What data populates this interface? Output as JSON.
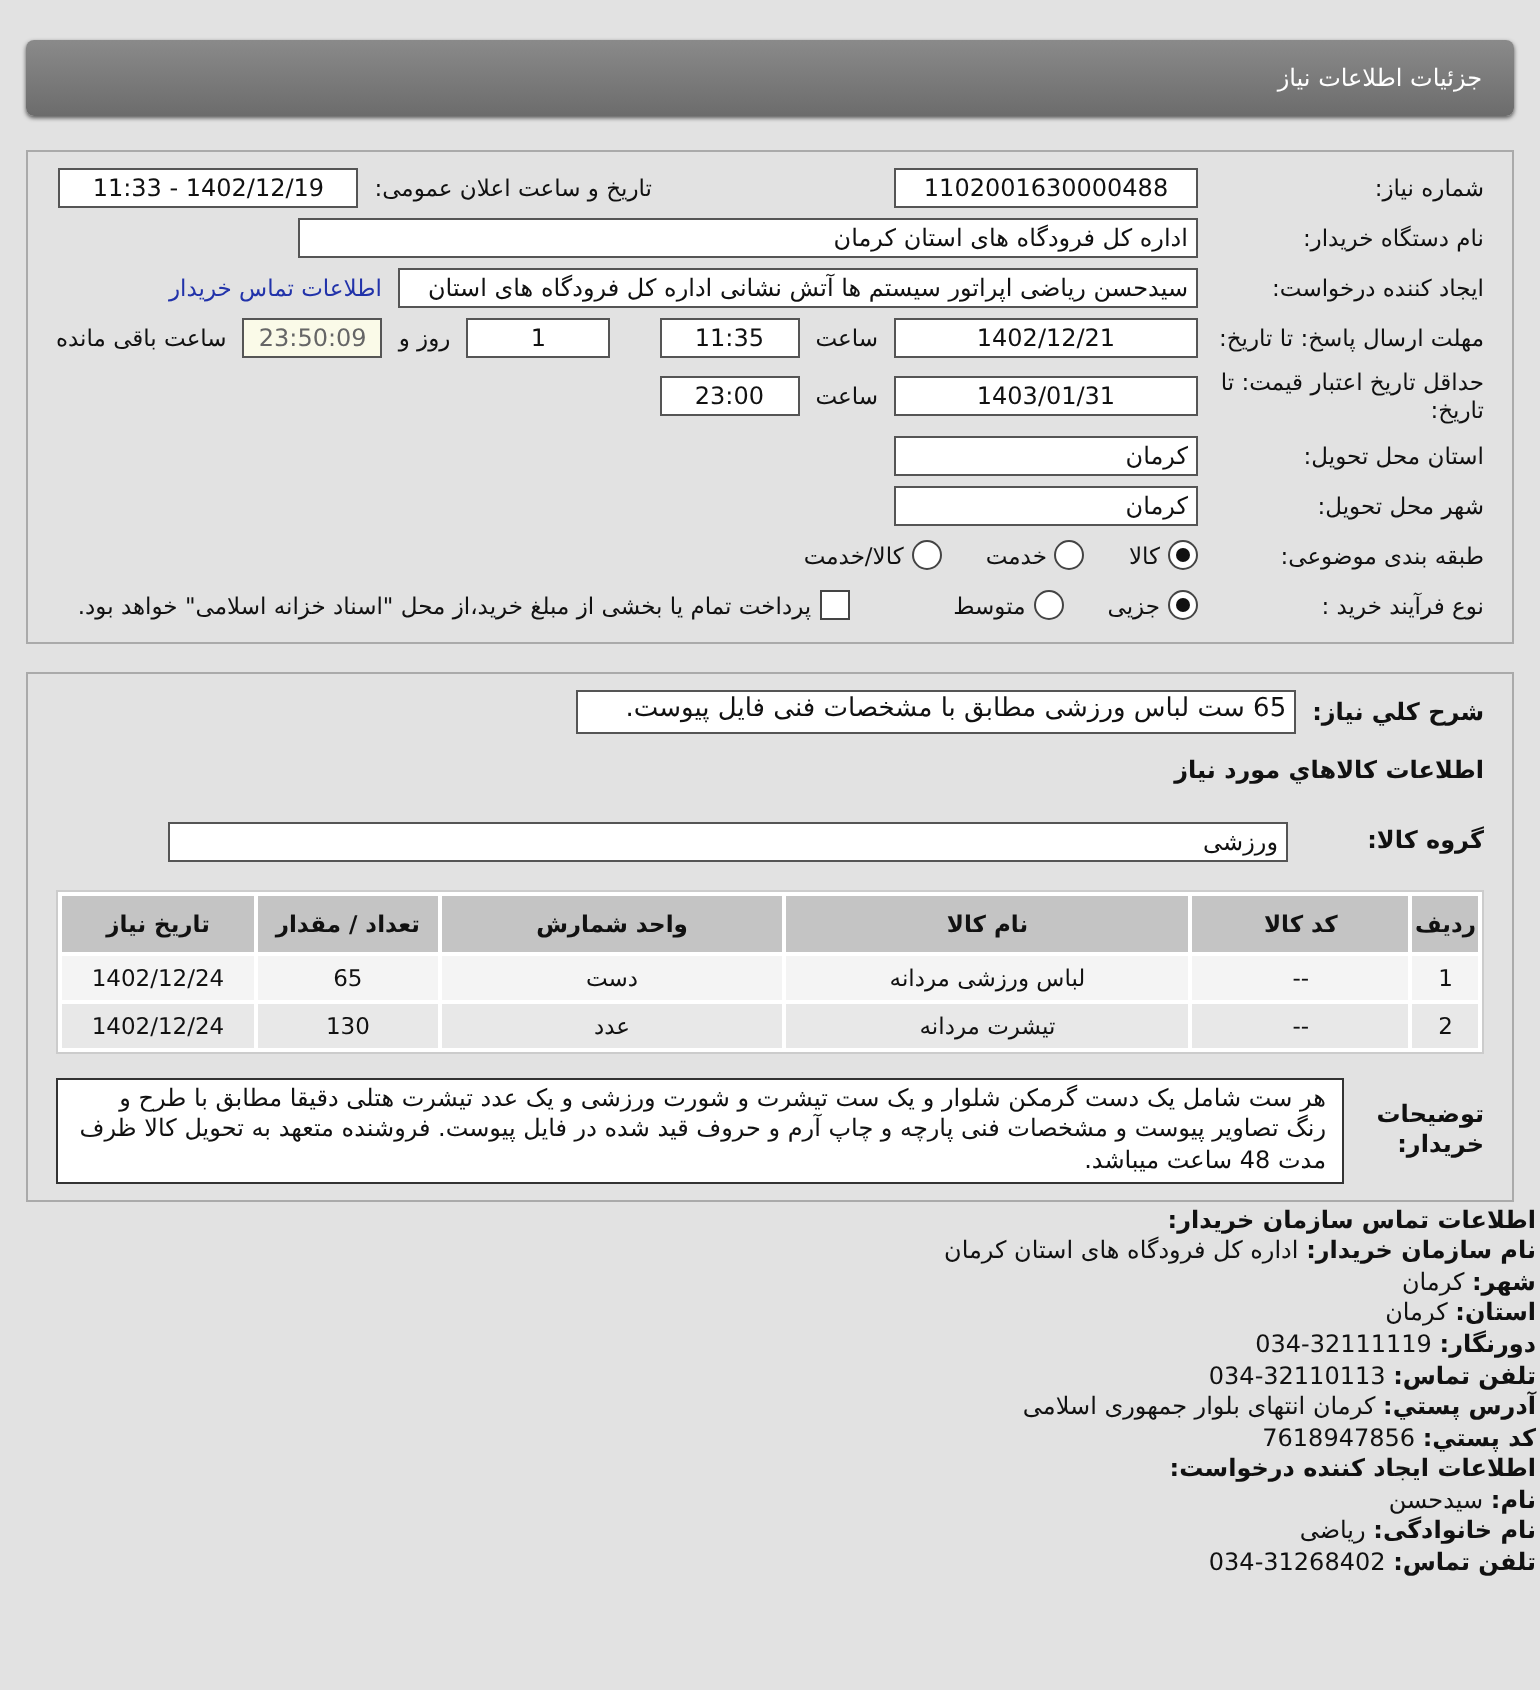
{
  "header": {
    "title": "جزئیات اطلاعات نیاز"
  },
  "form": {
    "need_number": {
      "label": "شماره نیاز:",
      "value": "1102001630000488"
    },
    "announce": {
      "label": "تاریخ و ساعت اعلان عمومی:",
      "value": "1402/12/19 - 11:33"
    },
    "buyer_org": {
      "label": "نام دستگاه خریدار:",
      "value": "اداره کل فرودگاه های استان کرمان"
    },
    "requester": {
      "label": "ایجاد کننده درخواست:",
      "value": "سیدحسن رياضی اپراتور سیستم ها آتش نشانی اداره کل فرودگاه های استان",
      "link": "اطلاعات تماس خریدار"
    },
    "deadline": {
      "label": "مهلت ارسال پاسخ: تا تاریخ:",
      "date": "1402/12/21",
      "time_label": "ساعت",
      "time": "11:35",
      "days": "1",
      "days_label": "روز و",
      "remaining": "23:50:09",
      "remaining_label": "ساعت باقی مانده"
    },
    "validity": {
      "label": "حداقل تاریخ اعتبار قیمت: تا تاریخ:",
      "date": "1403/01/31",
      "time_label": "ساعت",
      "time": "23:00"
    },
    "province": {
      "label": "استان محل تحویل:",
      "value": "کرمان"
    },
    "city": {
      "label": "شهر محل تحویل:",
      "value": "کرمان"
    },
    "category": {
      "label": "طبقه بندی موضوعی:",
      "options": [
        {
          "label": "کالا",
          "selected": true
        },
        {
          "label": "خدمت",
          "selected": false
        },
        {
          "label": "کالا/خدمت",
          "selected": false
        }
      ]
    },
    "process": {
      "label": "نوع فرآیند خرید :",
      "options": [
        {
          "label": "جزیی",
          "selected": true
        },
        {
          "label": "متوسط",
          "selected": false
        }
      ],
      "payment": {
        "label": "پرداخت تمام یا بخشی از مبلغ خرید،از محل \"اسناد خزانه اسلامی\" خواهد بود.",
        "checked": false
      }
    }
  },
  "summary": {
    "label": "شرح کلي نیاز:",
    "value": "65 ست لباس ورزشی مطابق با مشخصات فنی فایل پیوست."
  },
  "goods_title": "اطلاعات کالاهاي مورد نیاز",
  "group": {
    "label": "گروه کالا:",
    "value": "ورزشی"
  },
  "table": {
    "columns": [
      "ردیف",
      "کد کالا",
      "نام کالا",
      "واحد شمارش",
      "تعداد / مقدار",
      "تاریخ نیاز"
    ],
    "rows": [
      [
        "1",
        "--",
        "لباس ورزشی مردانه",
        "دست",
        "65",
        "1402/12/24"
      ],
      [
        "2",
        "--",
        "تیشرت مردانه",
        "عدد",
        "130",
        "1402/12/24"
      ]
    ]
  },
  "notes": {
    "label": "توضیحات خریدار:",
    "value": "هر ست شامل یک دست گرمکن شلوار و یک ست تیشرت و شورت ورزشی و یک عدد تیشرت هتلی دقیقا مطابق با طرح و رنگ تصاویر پیوست و مشخصات فنی پارچه و چاپ آرم و حروف قید شده در فایل پیوست. فروشنده متعهد به تحویل کالا ظرف مدت 48 ساعت میباشد."
  },
  "contact": [
    {
      "kind": "heading",
      "label": "اطلاعات تماس سازمان خریدار:"
    },
    {
      "kind": "line",
      "label": "نام سازمان خریدار:",
      "value": "اداره کل فرودگاه های استان کرمان"
    },
    {
      "kind": "line",
      "label": "شهر:",
      "value": "کرمان"
    },
    {
      "kind": "line",
      "label": "استان:",
      "value": "کرمان"
    },
    {
      "kind": "line",
      "label": "دورنگار:",
      "value": "32111119-034"
    },
    {
      "kind": "line",
      "label": "تلفن تماس:",
      "value": "32110113-034"
    },
    {
      "kind": "line",
      "label": "آدرس پستي:",
      "value": "کرمان انتهای بلوار جمهوری اسلامی"
    },
    {
      "kind": "line",
      "label": "کد پستي:",
      "value": "7618947856"
    },
    {
      "kind": "heading",
      "label": "اطلاعات ایجاد کننده درخواست:"
    },
    {
      "kind": "line",
      "label": "نام:",
      "value": "سیدحسن"
    },
    {
      "kind": "line",
      "label": "نام خانوادگی:",
      "value": "رياضی"
    },
    {
      "kind": "line",
      "label": "تلفن تماس:",
      "value": "31268402-034"
    }
  ]
}
